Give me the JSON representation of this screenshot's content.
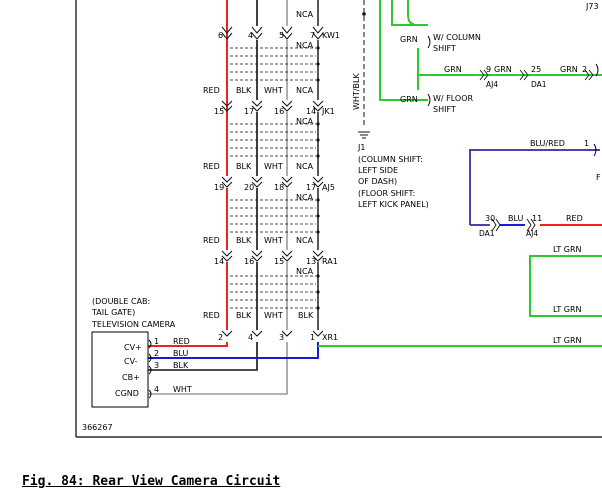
{
  "figure_id": "366267",
  "caption": "Fig. 84: Rear View Camera Circuit",
  "connectors": {
    "kw1": {
      "id": "KW1",
      "pins": [
        "6",
        "4",
        "5",
        "7"
      ],
      "colors": [
        "",
        "",
        "",
        "NCA"
      ]
    },
    "jk1": {
      "id": "JK1",
      "pins": [
        "15",
        "17",
        "16",
        "14"
      ],
      "colors": [
        "RED",
        "BLK",
        "WHT",
        "NCA"
      ]
    },
    "aj5": {
      "id": "AJ5",
      "pins": [
        "19",
        "20",
        "18",
        "17"
      ],
      "colors": [
        "RED",
        "BLK",
        "WHT",
        "NCA"
      ]
    },
    "ra1": {
      "id": "RA1",
      "pins": [
        "14",
        "16",
        "15",
        "13"
      ],
      "colors": [
        "RED",
        "BLK",
        "WHT",
        "NCA"
      ]
    },
    "xr1": {
      "id": "XR1",
      "pins": [
        "2",
        "4",
        "3",
        "1"
      ],
      "colors": [
        "RED",
        "BLK",
        "WHT",
        "BLK"
      ]
    }
  },
  "nca_below": [
    "NCA",
    "NCA",
    "NCA",
    "NCA"
  ],
  "camera": {
    "title_lines": [
      "(DOUBLE CAB:",
      "TAIL GATE)",
      "TELEVISION CAMERA"
    ],
    "pins": [
      {
        "name": "CV+",
        "pin": "1",
        "color": "RED"
      },
      {
        "name": "CV-",
        "pin": "2",
        "color": "BLU"
      },
      {
        "name": "CB+",
        "pin": "3",
        "color": "BLK"
      },
      {
        "name": "CGND",
        "pin": "4",
        "color": "WHT"
      }
    ]
  },
  "ground": {
    "wire": "WHT/BLK",
    "id": "J1",
    "note_lines": [
      "(COLUMN SHIFT:",
      "LEFT SIDE",
      "OF DASH)",
      "(FLOOR SHIFT:",
      "LEFT KICK PANEL)"
    ]
  },
  "shift": {
    "column": {
      "wire": "GRN",
      "label_lines": [
        "W/ COLUMN",
        "SHIFT"
      ]
    },
    "floor": {
      "wire": "GRN",
      "label_lines": [
        "W/ FLOOR",
        "SHIFT"
      ]
    }
  },
  "right_side": {
    "j73": "J73",
    "grn_run": {
      "segments": [
        "GRN",
        "GRN",
        "GRN"
      ],
      "pins": [
        "9",
        "25",
        "2"
      ],
      "connectors": [
        "AJ4",
        "DA1"
      ]
    },
    "blu_red": {
      "color": "BLU/RED",
      "pin": "1",
      "letter": "F"
    },
    "blu_red_run": {
      "pin_left": "30",
      "color_mid": "BLU",
      "pin_mid": "11",
      "color_right": "RED",
      "conn_left": "DA1",
      "conn_mid": "AJ4"
    },
    "lt_grn_labels": [
      "LT GRN",
      "LT GRN",
      "LT GRN"
    ]
  },
  "colors": {
    "red": "#e8241c",
    "blue": "#1a1ad6",
    "green": "#2fc82f",
    "purple": "#5a3ab4",
    "black": "#111111",
    "gray": "#9a9a9a"
  }
}
